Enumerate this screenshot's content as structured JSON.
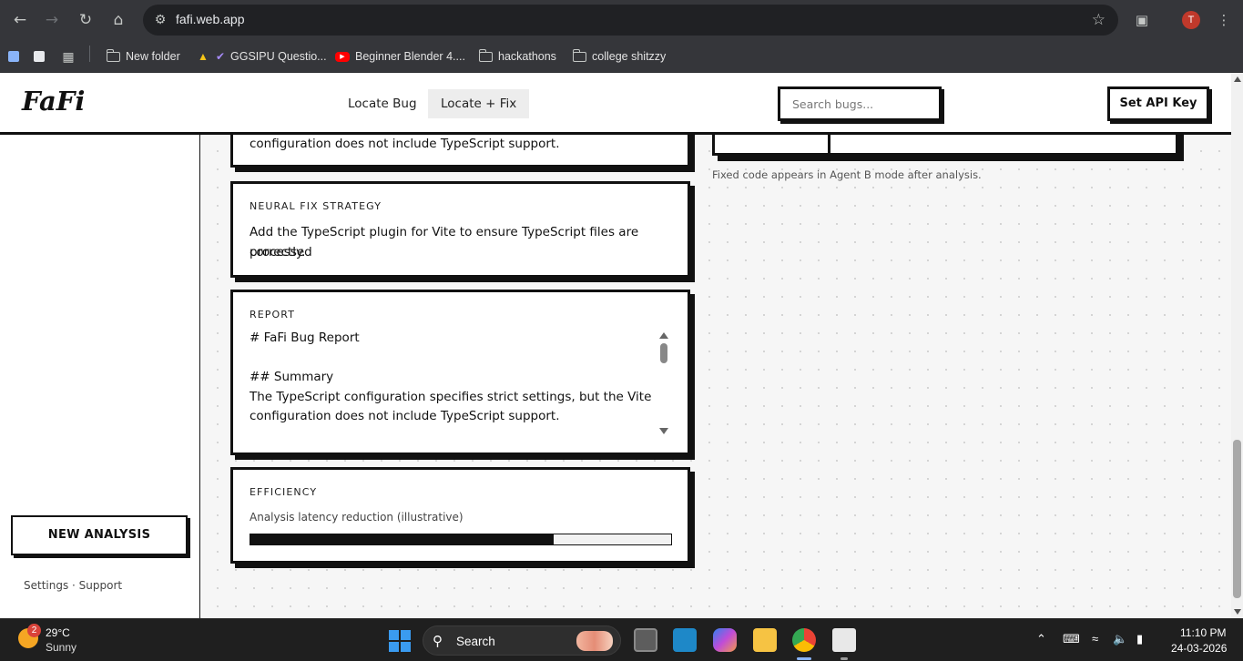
{
  "browser": {
    "url": "fafi.web.app",
    "avatar_letter": "T",
    "bookmarks": [
      {
        "label": "New folder",
        "icon": "folder-icon"
      },
      {
        "label": "GGSIPU Questio...",
        "icon": "ggsipu-icon"
      },
      {
        "label": "Beginner Blender 4....",
        "icon": "youtube-icon"
      },
      {
        "label": "hackathons",
        "icon": "folder-icon"
      },
      {
        "label": "college shitzzy",
        "icon": "folder-icon"
      }
    ]
  },
  "app": {
    "logo": "FaFi",
    "tabs": [
      {
        "label": "Locate Bug",
        "active": false
      },
      {
        "label": "Locate + Fix",
        "active": true
      }
    ],
    "search_placeholder": "Search bugs...",
    "api_button": "Set API Key"
  },
  "sidebar": {
    "new_analysis": "NEW ANALYSIS",
    "links": "Settings · Support"
  },
  "cards": {
    "partial_text": "configuration does not include TypeScript support.",
    "fix_strategy": {
      "label": "NEURAL FIX STRATEGY",
      "line1": "Add the TypeScript plugin for Vite to ensure TypeScript files are processed",
      "line2": "correctly."
    },
    "report": {
      "label": "REPORT",
      "lines": [
        "# FaFi Bug Report",
        "",
        "## Summary",
        "The TypeScript configuration specifies strict settings, but the Vite",
        "configuration does not include TypeScript support."
      ]
    },
    "efficiency": {
      "label": "EFFICIENCY",
      "caption": "Analysis latency reduction (illustrative)",
      "progress_fraction": 0.72
    }
  },
  "right_panel": {
    "note": "Fixed code appears in Agent B mode after analysis."
  },
  "taskbar": {
    "weather_temp": "29°C",
    "weather_cond": "Sunny",
    "weather_badge": "2",
    "search_label": "Search",
    "time": "11:10 PM",
    "date": "24-03-2026"
  }
}
